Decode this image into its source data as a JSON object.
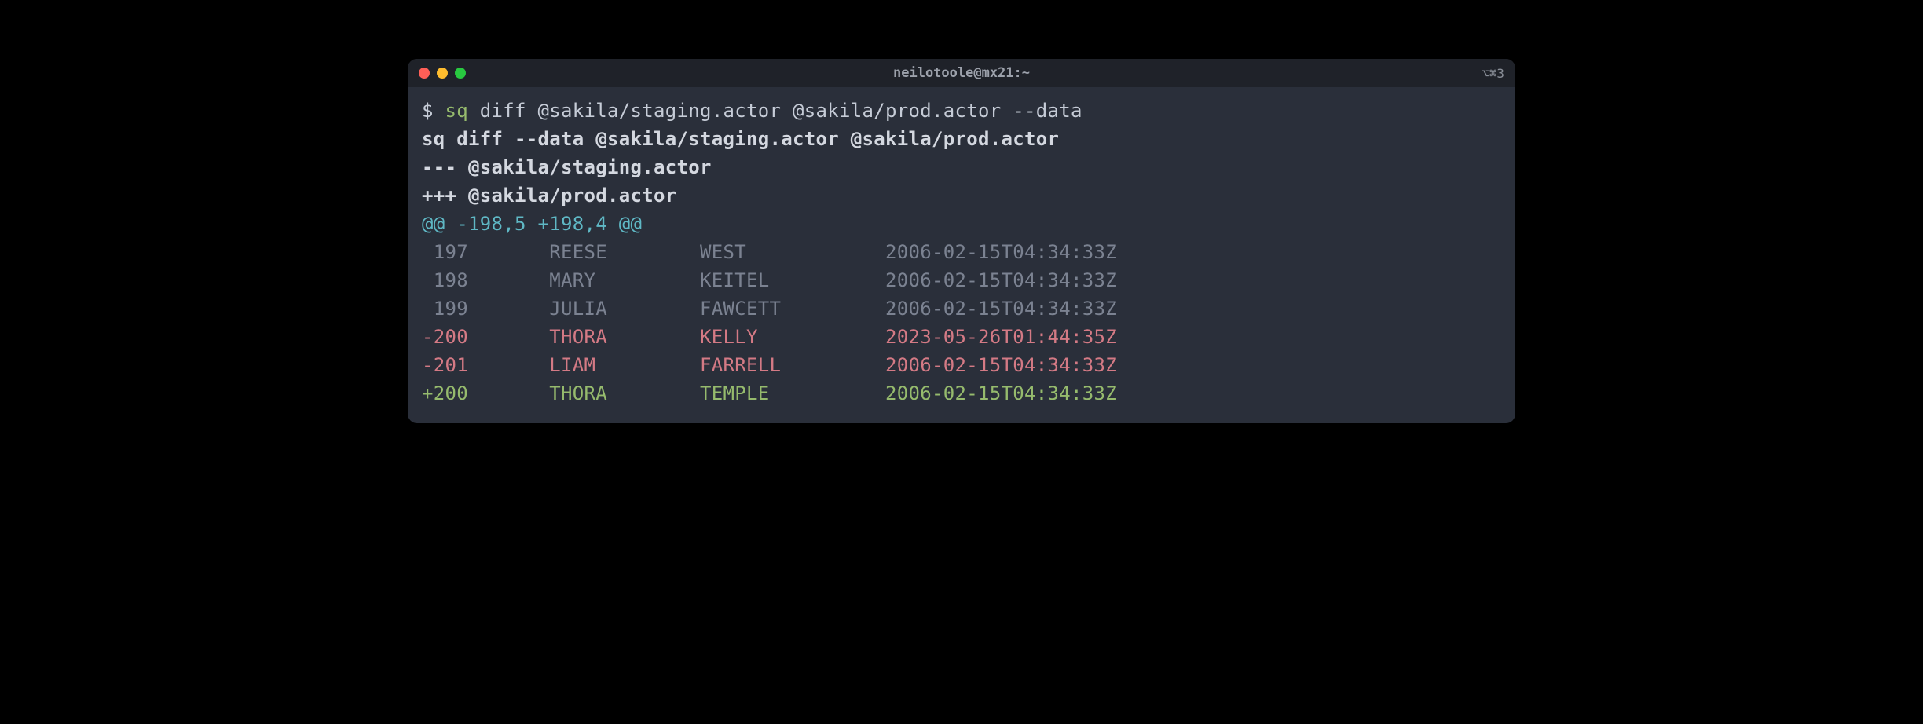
{
  "titlebar": {
    "title": "neilotoole@mx21:~",
    "right_indicator": "⌥⌘3"
  },
  "prompt": {
    "symbol": "$ ",
    "command_name": "sq",
    "command_args": " diff @sakila/staging.actor @sakila/prod.actor --data"
  },
  "output": {
    "echo_line": "sq diff --data @sakila/staging.actor @sakila/prod.actor",
    "minus_header": "--- @sakila/staging.actor",
    "plus_header": "+++ @sakila/prod.actor",
    "hunk": "@@ -198,5 +198,4 @@",
    "rows": [
      {
        "type": "context",
        "text": " 197       REESE        WEST            2006-02-15T04:34:33Z"
      },
      {
        "type": "context",
        "text": " 198       MARY         KEITEL          2006-02-15T04:34:33Z"
      },
      {
        "type": "context",
        "text": " 199       JULIA        FAWCETT         2006-02-15T04:34:33Z"
      },
      {
        "type": "removed",
        "text": "-200       THORA        KELLY           2023-05-26T01:44:35Z"
      },
      {
        "type": "removed",
        "text": "-201       LIAM         FARRELL         2006-02-15T04:34:33Z"
      },
      {
        "type": "added",
        "text": "+200       THORA        TEMPLE          2006-02-15T04:34:33Z"
      }
    ]
  }
}
